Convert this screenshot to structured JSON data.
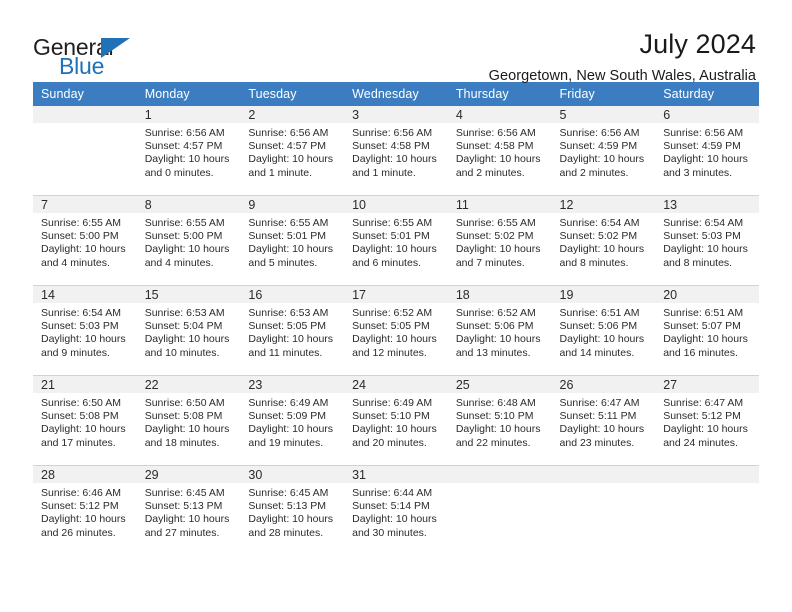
{
  "brand": {
    "name_part1": "General",
    "name_part2": "Blue",
    "triangle_color": "#1f71b8"
  },
  "header": {
    "title": "July 2024",
    "subtitle": "Georgetown, New South Wales, Australia"
  },
  "calendar": {
    "header_bg": "#3b7dc0",
    "daynum_bg": "#f1f1f1",
    "weekday_headers": [
      "Sunday",
      "Monday",
      "Tuesday",
      "Wednesday",
      "Thursday",
      "Friday",
      "Saturday"
    ],
    "weeks": [
      [
        {
          "day": "",
          "lines": []
        },
        {
          "day": "1",
          "lines": [
            "Sunrise: 6:56 AM",
            "Sunset: 4:57 PM",
            "Daylight: 10 hours",
            "and 0 minutes."
          ]
        },
        {
          "day": "2",
          "lines": [
            "Sunrise: 6:56 AM",
            "Sunset: 4:57 PM",
            "Daylight: 10 hours",
            "and 1 minute."
          ]
        },
        {
          "day": "3",
          "lines": [
            "Sunrise: 6:56 AM",
            "Sunset: 4:58 PM",
            "Daylight: 10 hours",
            "and 1 minute."
          ]
        },
        {
          "day": "4",
          "lines": [
            "Sunrise: 6:56 AM",
            "Sunset: 4:58 PM",
            "Daylight: 10 hours",
            "and 2 minutes."
          ]
        },
        {
          "day": "5",
          "lines": [
            "Sunrise: 6:56 AM",
            "Sunset: 4:59 PM",
            "Daylight: 10 hours",
            "and 2 minutes."
          ]
        },
        {
          "day": "6",
          "lines": [
            "Sunrise: 6:56 AM",
            "Sunset: 4:59 PM",
            "Daylight: 10 hours",
            "and 3 minutes."
          ]
        }
      ],
      [
        {
          "day": "7",
          "lines": [
            "Sunrise: 6:55 AM",
            "Sunset: 5:00 PM",
            "Daylight: 10 hours",
            "and 4 minutes."
          ]
        },
        {
          "day": "8",
          "lines": [
            "Sunrise: 6:55 AM",
            "Sunset: 5:00 PM",
            "Daylight: 10 hours",
            "and 4 minutes."
          ]
        },
        {
          "day": "9",
          "lines": [
            "Sunrise: 6:55 AM",
            "Sunset: 5:01 PM",
            "Daylight: 10 hours",
            "and 5 minutes."
          ]
        },
        {
          "day": "10",
          "lines": [
            "Sunrise: 6:55 AM",
            "Sunset: 5:01 PM",
            "Daylight: 10 hours",
            "and 6 minutes."
          ]
        },
        {
          "day": "11",
          "lines": [
            "Sunrise: 6:55 AM",
            "Sunset: 5:02 PM",
            "Daylight: 10 hours",
            "and 7 minutes."
          ]
        },
        {
          "day": "12",
          "lines": [
            "Sunrise: 6:54 AM",
            "Sunset: 5:02 PM",
            "Daylight: 10 hours",
            "and 8 minutes."
          ]
        },
        {
          "day": "13",
          "lines": [
            "Sunrise: 6:54 AM",
            "Sunset: 5:03 PM",
            "Daylight: 10 hours",
            "and 8 minutes."
          ]
        }
      ],
      [
        {
          "day": "14",
          "lines": [
            "Sunrise: 6:54 AM",
            "Sunset: 5:03 PM",
            "Daylight: 10 hours",
            "and 9 minutes."
          ]
        },
        {
          "day": "15",
          "lines": [
            "Sunrise: 6:53 AM",
            "Sunset: 5:04 PM",
            "Daylight: 10 hours",
            "and 10 minutes."
          ]
        },
        {
          "day": "16",
          "lines": [
            "Sunrise: 6:53 AM",
            "Sunset: 5:05 PM",
            "Daylight: 10 hours",
            "and 11 minutes."
          ]
        },
        {
          "day": "17",
          "lines": [
            "Sunrise: 6:52 AM",
            "Sunset: 5:05 PM",
            "Daylight: 10 hours",
            "and 12 minutes."
          ]
        },
        {
          "day": "18",
          "lines": [
            "Sunrise: 6:52 AM",
            "Sunset: 5:06 PM",
            "Daylight: 10 hours",
            "and 13 minutes."
          ]
        },
        {
          "day": "19",
          "lines": [
            "Sunrise: 6:51 AM",
            "Sunset: 5:06 PM",
            "Daylight: 10 hours",
            "and 14 minutes."
          ]
        },
        {
          "day": "20",
          "lines": [
            "Sunrise: 6:51 AM",
            "Sunset: 5:07 PM",
            "Daylight: 10 hours",
            "and 16 minutes."
          ]
        }
      ],
      [
        {
          "day": "21",
          "lines": [
            "Sunrise: 6:50 AM",
            "Sunset: 5:08 PM",
            "Daylight: 10 hours",
            "and 17 minutes."
          ]
        },
        {
          "day": "22",
          "lines": [
            "Sunrise: 6:50 AM",
            "Sunset: 5:08 PM",
            "Daylight: 10 hours",
            "and 18 minutes."
          ]
        },
        {
          "day": "23",
          "lines": [
            "Sunrise: 6:49 AM",
            "Sunset: 5:09 PM",
            "Daylight: 10 hours",
            "and 19 minutes."
          ]
        },
        {
          "day": "24",
          "lines": [
            "Sunrise: 6:49 AM",
            "Sunset: 5:10 PM",
            "Daylight: 10 hours",
            "and 20 minutes."
          ]
        },
        {
          "day": "25",
          "lines": [
            "Sunrise: 6:48 AM",
            "Sunset: 5:10 PM",
            "Daylight: 10 hours",
            "and 22 minutes."
          ]
        },
        {
          "day": "26",
          "lines": [
            "Sunrise: 6:47 AM",
            "Sunset: 5:11 PM",
            "Daylight: 10 hours",
            "and 23 minutes."
          ]
        },
        {
          "day": "27",
          "lines": [
            "Sunrise: 6:47 AM",
            "Sunset: 5:12 PM",
            "Daylight: 10 hours",
            "and 24 minutes."
          ]
        }
      ],
      [
        {
          "day": "28",
          "lines": [
            "Sunrise: 6:46 AM",
            "Sunset: 5:12 PM",
            "Daylight: 10 hours",
            "and 26 minutes."
          ]
        },
        {
          "day": "29",
          "lines": [
            "Sunrise: 6:45 AM",
            "Sunset: 5:13 PM",
            "Daylight: 10 hours",
            "and 27 minutes."
          ]
        },
        {
          "day": "30",
          "lines": [
            "Sunrise: 6:45 AM",
            "Sunset: 5:13 PM",
            "Daylight: 10 hours",
            "and 28 minutes."
          ]
        },
        {
          "day": "31",
          "lines": [
            "Sunrise: 6:44 AM",
            "Sunset: 5:14 PM",
            "Daylight: 10 hours",
            "and 30 minutes."
          ]
        },
        {
          "day": "",
          "lines": []
        },
        {
          "day": "",
          "lines": []
        },
        {
          "day": "",
          "lines": []
        }
      ]
    ]
  }
}
